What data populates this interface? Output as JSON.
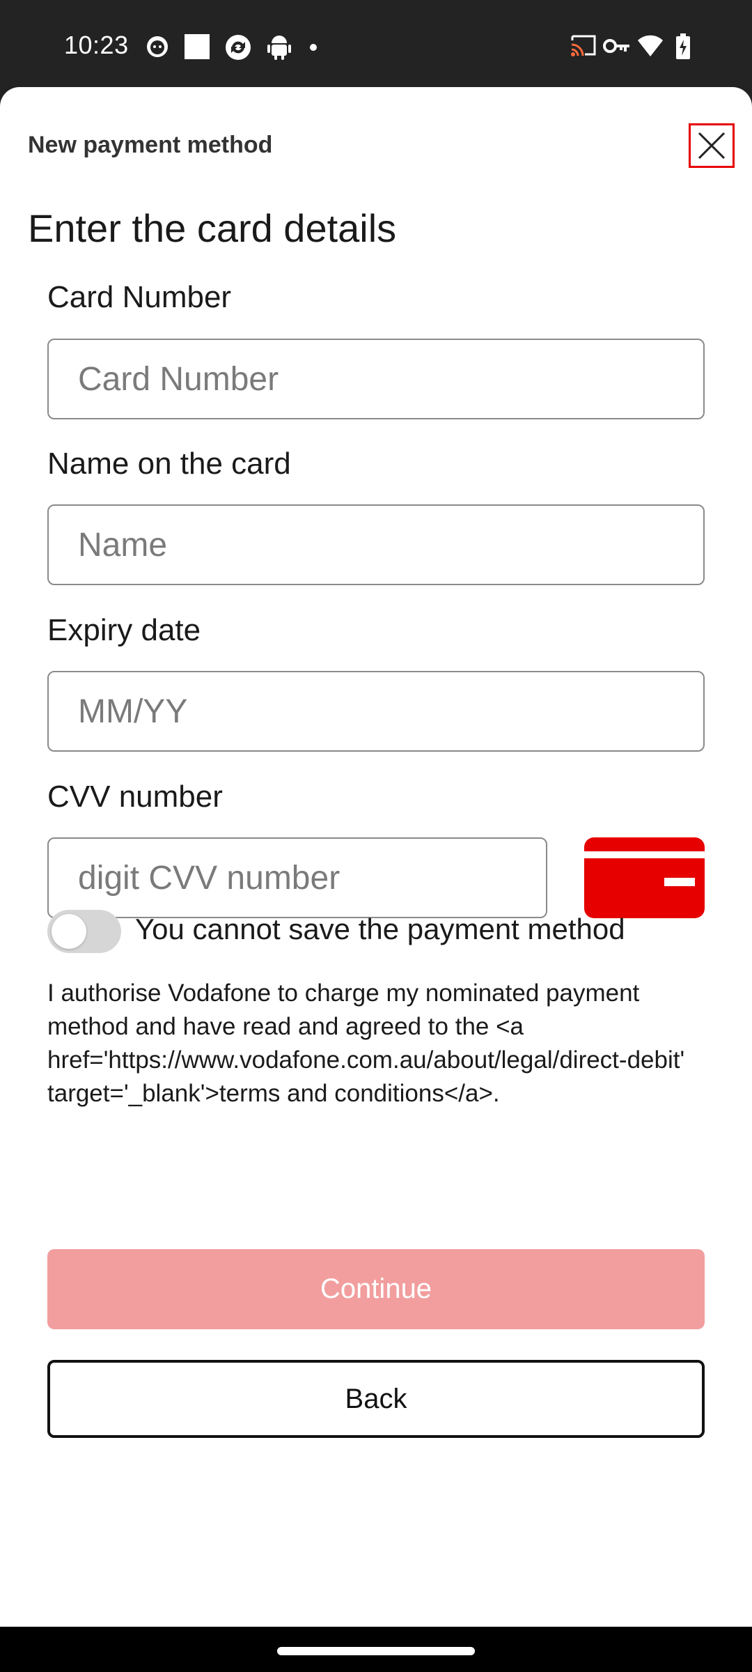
{
  "status_bar": {
    "time": "10:23",
    "left_icons": [
      "cat-notification-icon",
      "square-icon",
      "sync-icon",
      "android-icon",
      "dot-icon"
    ],
    "right_icons": [
      "cast-icon",
      "vpn-key-icon",
      "wifi-icon",
      "battery-charging-icon"
    ]
  },
  "sheet": {
    "title": "New payment method",
    "heading": "Enter the card details"
  },
  "form": {
    "card_number": {
      "label": "Card Number",
      "placeholder": "Card Number",
      "value": ""
    },
    "name": {
      "label": "Name on the card",
      "placeholder": "Name",
      "value": ""
    },
    "expiry": {
      "label": "Expiry date",
      "placeholder": "MM/YY",
      "value": ""
    },
    "cvv": {
      "label": "CVV number",
      "placeholder": "digit CVV number",
      "value": ""
    }
  },
  "save_toggle": {
    "label": "You cannot save the payment method",
    "checked": false
  },
  "legal_text": "I authorise Vodafone to charge my nominated payment method and have read and agreed to the <a href='https://www.vodafone.com.au/about/legal/direct-debit' target='_blank'>terms and conditions</a>.",
  "buttons": {
    "continue": "Continue",
    "back": "Back"
  },
  "colors": {
    "accent": "#e60000",
    "continue_disabled": "#f29e9e",
    "toggle_off": "#d6d6d6"
  }
}
